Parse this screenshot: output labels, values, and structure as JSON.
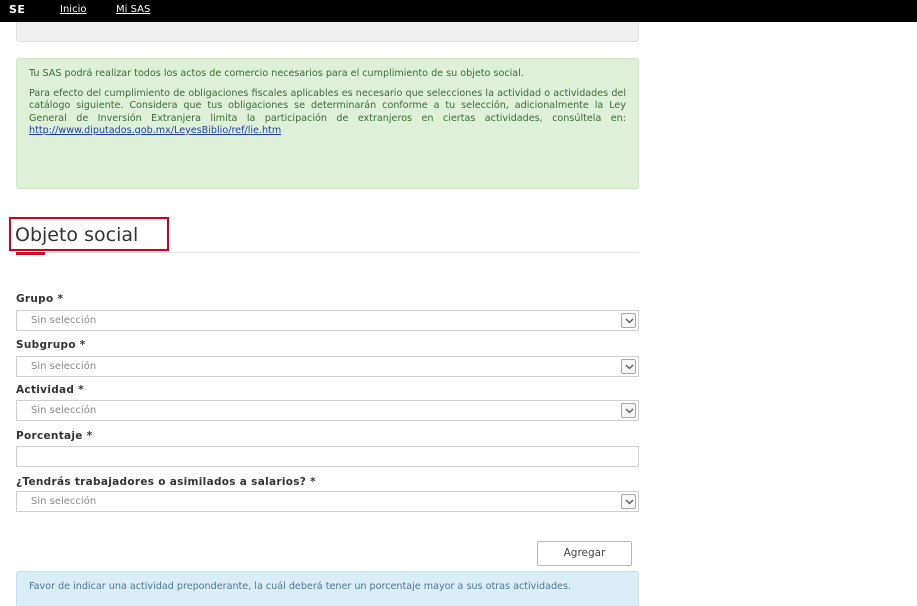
{
  "nav": {
    "brand": "SE",
    "links": [
      "Inicio",
      "Mi SAS"
    ]
  },
  "info": {
    "paragraph1": "Tu SAS podrá realizar todos los actos de comercio necesarios para el cumplimiento de su objeto social.",
    "paragraph2": "Para efecto del cumplimiento de obligaciones fiscales aplicables es necesario que selecciones la actividad o actividades del catálogo siguiente. Considera que tus obligaciones se determinarán conforme a tu selección, adicionalmente la Ley General de Inversión Extranjera limita la participación de extranjeros en ciertas actividades, consúltela en:",
    "link": "http://www.diputados.gob.mx/LeyesBiblio/ref/lie.htm"
  },
  "section": {
    "title": "Objeto social"
  },
  "form": {
    "grupo_label": "Grupo *",
    "grupo_value": "Sin selección",
    "subgrupo_label": "Subgrupo *",
    "subgrupo_value": "Sin selección",
    "actividad_label": "Actividad *",
    "actividad_value": "Sin selección",
    "porcentaje_label": "Porcentaje *",
    "porcentaje_value": "",
    "trabajadores_label": "¿Tendrás trabajadores o asimilados a salarios? *",
    "trabajadores_value": "Sin selección",
    "add_button": "Agregar"
  },
  "notice": {
    "text": "Favor de indicar una actividad preponderante, la cuál deberá tener un porcentaje mayor a sus otras actividades."
  },
  "colors": {
    "accent": "#c8102e",
    "success_bg": "#dff0d8",
    "info_bg": "#d9edf7",
    "topbar": "#000000"
  }
}
